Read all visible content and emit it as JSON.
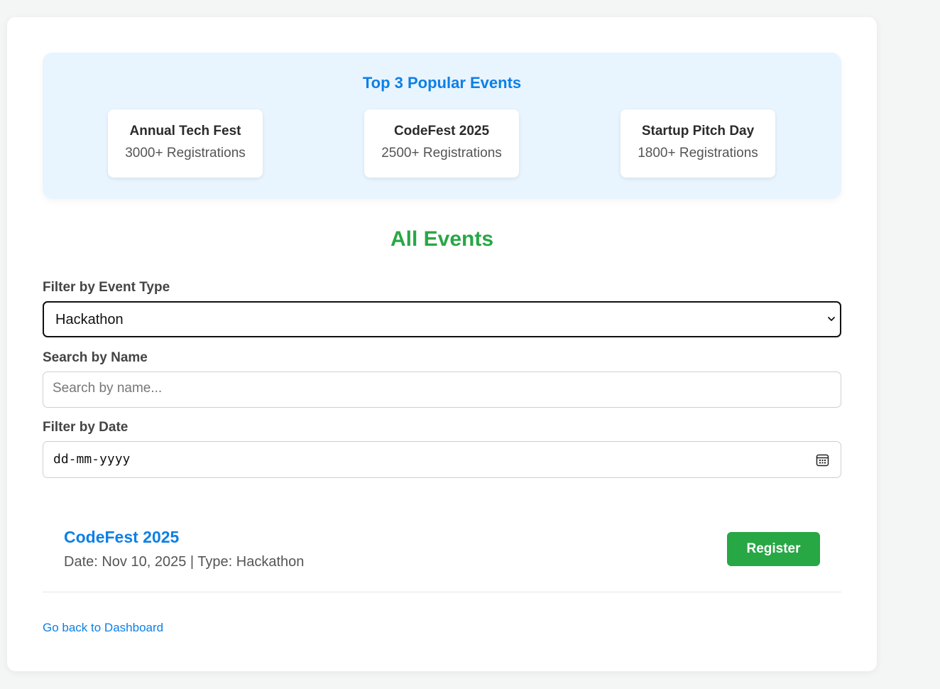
{
  "popular": {
    "title": "Top 3 Popular Events",
    "events": [
      {
        "name": "Annual Tech Fest",
        "registrations": "3000+ Registrations"
      },
      {
        "name": "CodeFest 2025",
        "registrations": "2500+ Registrations"
      },
      {
        "name": "Startup Pitch Day",
        "registrations": "1800+ Registrations"
      }
    ]
  },
  "all_events": {
    "title": "All Events"
  },
  "filters": {
    "type_label": "Filter by Event Type",
    "type_value": "Hackathon",
    "name_label": "Search by Name",
    "name_placeholder": "Search by name...",
    "date_label": "Filter by Date",
    "date_placeholder": "dd-mm-yyyy"
  },
  "events": [
    {
      "name": "CodeFest 2025",
      "meta": "Date: Nov 10, 2025 | Type: Hackathon",
      "register_label": "Register"
    }
  ],
  "footer": {
    "back_link": "Go back to Dashboard"
  },
  "colors": {
    "primary_blue": "#0d7fe6",
    "green": "#28a745",
    "popular_bg": "#e8f4fe"
  },
  "icons": {
    "select_arrow": "chevron-down-icon",
    "date_picker": "calendar-icon"
  }
}
